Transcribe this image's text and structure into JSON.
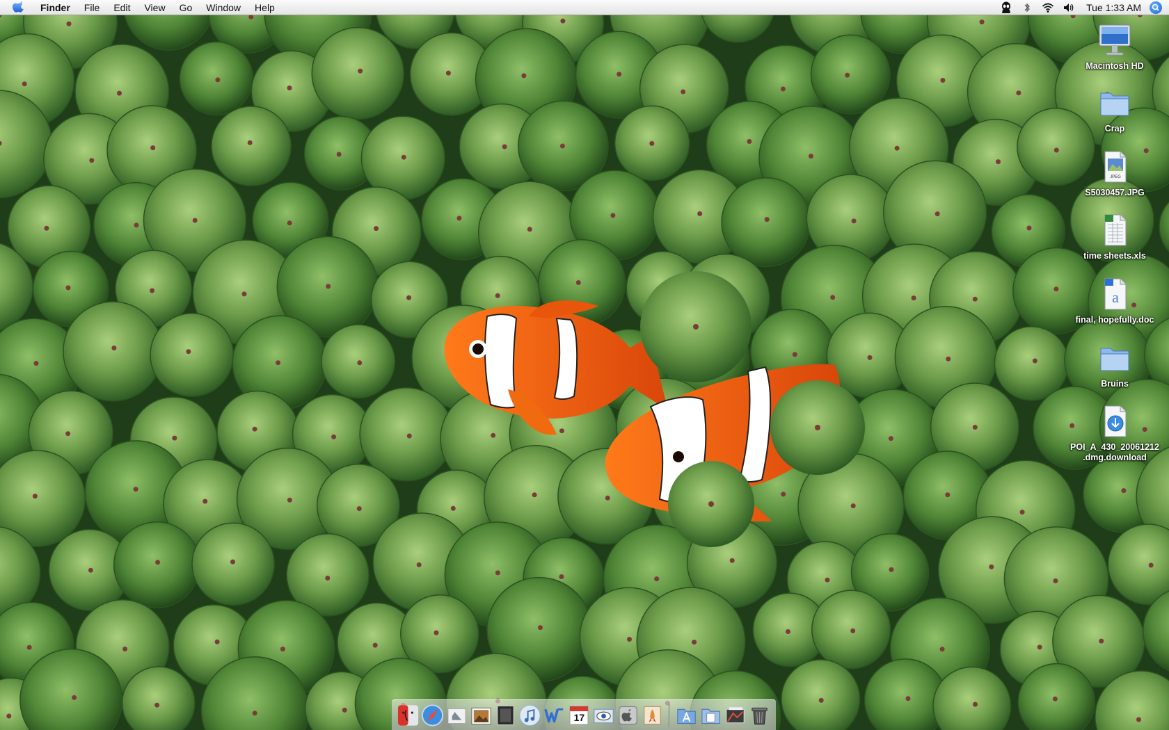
{
  "menubar": {
    "apple_icon": "apple-logo-icon",
    "app_name": "Finder",
    "menus": [
      "File",
      "Edit",
      "View",
      "Go",
      "Window",
      "Help"
    ],
    "status_icons": [
      "growl-alien-icon",
      "bluetooth-icon",
      "wifi-icon",
      "volume-icon"
    ],
    "clock": "Tue 1:33 AM",
    "spotlight_icon": "spotlight-icon"
  },
  "desktop": {
    "icons": [
      {
        "label": "Macintosh HD",
        "icon": "hard-drive-icon"
      },
      {
        "label": "Crap",
        "icon": "folder-icon"
      },
      {
        "label": "S5030457.JPG",
        "icon": "jpeg-file-icon"
      },
      {
        "label": "time sheets.xls",
        "icon": "excel-file-icon"
      },
      {
        "label": "final, hopefully.doc",
        "icon": "word-file-icon"
      },
      {
        "label": "Bruins",
        "icon": "folder-icon"
      },
      {
        "label": "POI_A_430_20061212\n.dmg.download",
        "icon": "download-file-icon"
      }
    ]
  },
  "dock": {
    "apps": [
      {
        "name": "finder",
        "icon": "finder-face-icon",
        "color": "#d8322b"
      },
      {
        "name": "safari",
        "icon": "safari-compass-icon",
        "color": "#3a8de0"
      },
      {
        "name": "mail",
        "icon": "mail-stamp-icon",
        "color": "#c9c9c9"
      },
      {
        "name": "iphoto",
        "icon": "iphoto-icon",
        "color": "#8a5a2a"
      },
      {
        "name": "image-capture",
        "icon": "photo-frame-icon",
        "color": "#2b2b2b"
      },
      {
        "name": "itunes",
        "icon": "itunes-icon",
        "color": "#8fb8e0"
      },
      {
        "name": "word",
        "icon": "word-app-icon",
        "color": "#2f6fd6"
      },
      {
        "name": "ical",
        "icon": "ical-calendar-icon",
        "color": "#ffffff",
        "badge": "17"
      },
      {
        "name": "preview",
        "icon": "preview-eye-icon",
        "color": "#6e8fb8"
      },
      {
        "name": "system-preferences",
        "icon": "system-prefs-apple-icon",
        "color": "#9a9a9a"
      },
      {
        "name": "rocket",
        "icon": "rocket-app-icon",
        "color": "#e08a3a"
      }
    ],
    "docs": [
      {
        "name": "applications-stack",
        "icon": "applications-folder-icon",
        "color": "#7aa8e0"
      },
      {
        "name": "documents-stack",
        "icon": "documents-folder-icon",
        "color": "#9ec0e8"
      },
      {
        "name": "downloads-stack",
        "icon": "downloads-stack-icon",
        "color": "#3a3a3a"
      },
      {
        "name": "trash",
        "icon": "trash-can-icon",
        "color": "#555555"
      }
    ]
  },
  "colors": {
    "wallpaper_dark": "#2f5a22",
    "anemone_green": "#6f9d4c",
    "clownfish_orange": "#e8560c"
  }
}
